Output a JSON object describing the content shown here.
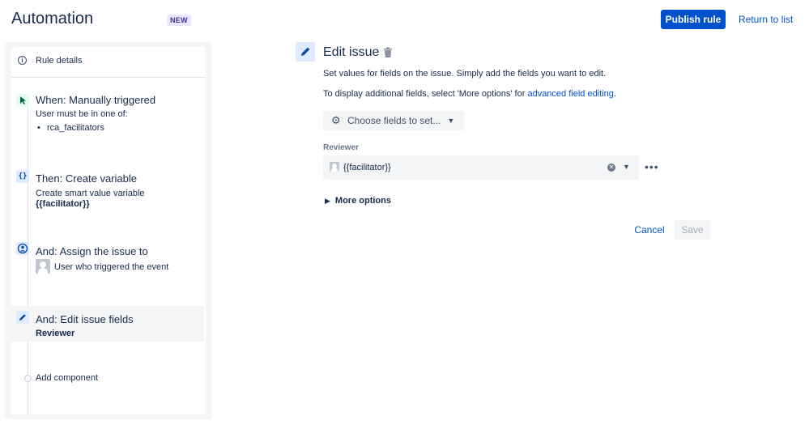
{
  "header": {
    "title": "Automation",
    "badge": "NEW",
    "publish_label": "Publish rule",
    "return_label": "Return to list"
  },
  "sidebar": {
    "rule_details": "Rule details",
    "steps": [
      {
        "title": "When: Manually triggered",
        "line1": "User must be in one of:",
        "bullet": "rca_facilitators"
      },
      {
        "title": "Then: Create variable",
        "line1": "Create smart value variable",
        "line2": "{{facilitator}}"
      },
      {
        "title": "And: Assign the issue to",
        "line1": "User who triggered the event"
      },
      {
        "title": "And: Edit issue fields",
        "line1": "Reviewer"
      }
    ],
    "add_component": "Add component"
  },
  "editor": {
    "title": "Edit issue",
    "description": "Set values for fields on the issue. Simply add the fields you want to edit.",
    "hint_prefix": "To display additional fields, select 'More options' for ",
    "hint_link": "advanced field editing",
    "hint_suffix": ".",
    "choose_fields_label": "Choose fields to set...",
    "field_label": "Reviewer",
    "field_value": "{{facilitator}}",
    "more_options": "More options",
    "cancel_label": "Cancel",
    "save_label": "Save"
  },
  "colors": {
    "primary": "#0052cc",
    "text": "#172b4d",
    "panel_bg": "#f4f5f7"
  }
}
